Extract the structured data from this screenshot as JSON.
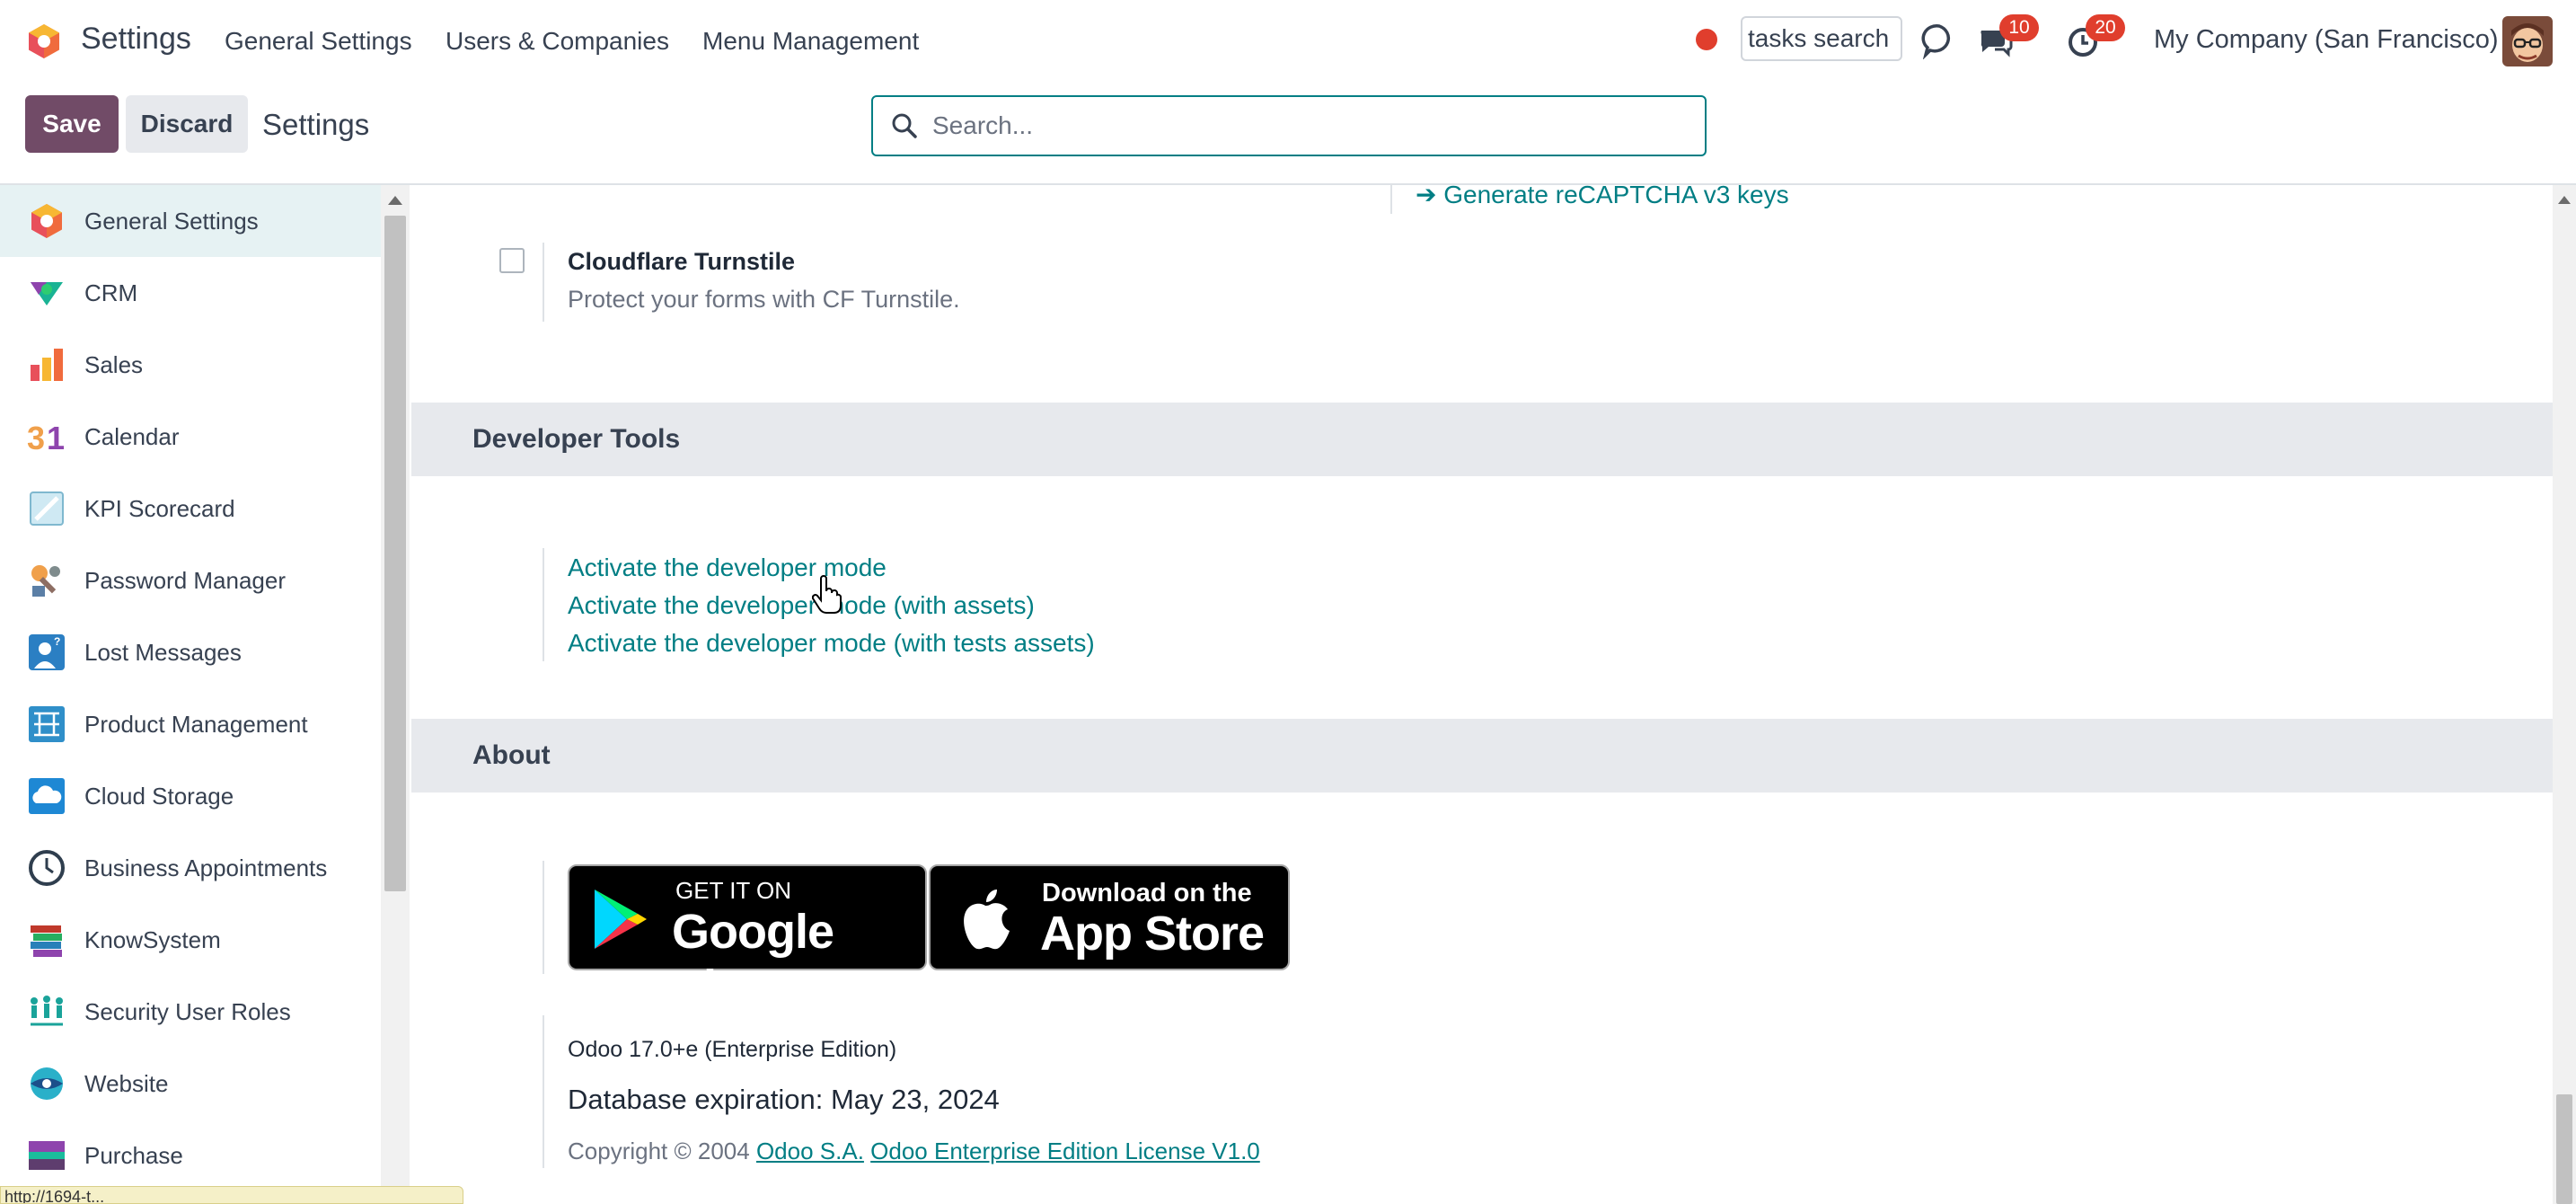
{
  "topnav": {
    "app_title": "Settings",
    "menus": [
      "General Settings",
      "Users & Companies",
      "Menu Management"
    ],
    "tasks_search_value": "tasks search",
    "chat_badge": "10",
    "activity_badge": "20",
    "company": "My Company (San Francisco)"
  },
  "control_panel": {
    "save_label": "Save",
    "discard_label": "Discard",
    "title": "Settings",
    "search_placeholder": "Search..."
  },
  "sidebar": {
    "items": [
      {
        "label": "General Settings",
        "icon": "odoo-logo-icon",
        "active": true
      },
      {
        "label": "CRM",
        "icon": "crm-icon"
      },
      {
        "label": "Sales",
        "icon": "sales-chart-icon"
      },
      {
        "label": "Calendar",
        "icon": "calendar-31-icon"
      },
      {
        "label": "KPI Scorecard",
        "icon": "scorecard-icon"
      },
      {
        "label": "Password Manager",
        "icon": "password-manager-icon"
      },
      {
        "label": "Lost Messages",
        "icon": "lost-messages-icon"
      },
      {
        "label": "Product Management",
        "icon": "product-management-icon"
      },
      {
        "label": "Cloud Storage",
        "icon": "cloud-storage-icon"
      },
      {
        "label": "Business Appointments",
        "icon": "clock-icon"
      },
      {
        "label": "KnowSystem",
        "icon": "books-icon"
      },
      {
        "label": "Security User Roles",
        "icon": "user-roles-icon"
      },
      {
        "label": "Website",
        "icon": "website-icon"
      },
      {
        "label": "Purchase",
        "icon": "purchase-icon"
      }
    ]
  },
  "content": {
    "recaptcha_link": "Generate reCAPTCHA v3 keys",
    "turnstile": {
      "title": "Cloudflare Turnstile",
      "description": "Protect your forms with CF Turnstile."
    },
    "developer_tools": {
      "header": "Developer Tools",
      "links": [
        "Activate the developer mode",
        "Activate the developer mode (with assets)",
        "Activate the developer mode (with tests assets)"
      ]
    },
    "about": {
      "header": "About",
      "google_play_small": "GET IT ON",
      "google_play_big": "Google Play",
      "app_store_small": "Download on the",
      "app_store_big": "App Store",
      "version": "Odoo 17.0+e (Enterprise Edition)",
      "expiration": "Database expiration: May 23, 2024",
      "copyright_prefix": "Copyright © 2004",
      "company_link": "Odoo S.A.",
      "license_link": "Odoo Enterprise Edition License V1.0"
    }
  },
  "status_bar": {
    "url": "http://1694-t..."
  },
  "colors": {
    "primary": "#714b67",
    "link": "#017e84",
    "section_bg": "#e7e9ed",
    "active_sidebar_bg": "#e6f2f3",
    "badge": "#e03e2d"
  }
}
